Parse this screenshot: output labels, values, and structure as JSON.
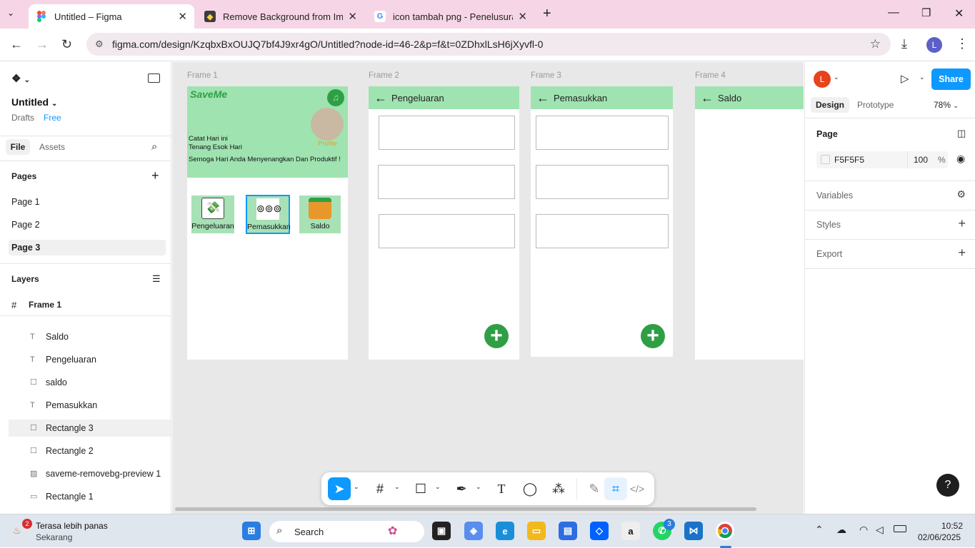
{
  "browser": {
    "tabs": [
      {
        "title": "Untitled – Figma",
        "favicon": "figma-icon",
        "active": true
      },
      {
        "title": "Remove Background from Imag",
        "favicon": "removebg-icon",
        "active": false
      },
      {
        "title": "icon tambah png - Penelusuran",
        "favicon": "google-icon",
        "active": false
      }
    ],
    "url": "figma.com/design/KzqbxBxOUJQ7bf4J9xr4gO/Untitled?node-id=46-2&p=f&t=0ZDhxlLsH6jXyvfl-0",
    "profile_initial": "L"
  },
  "left_panel": {
    "file_title": "Untitled",
    "drafts_label": "Drafts",
    "plan_badge": "Free",
    "tab_file": "File",
    "tab_assets": "Assets",
    "pages_heading": "Pages",
    "pages": [
      "Page 1",
      "Page 2",
      "Page 3"
    ],
    "selected_page": "Page 3",
    "layers_heading": "Layers",
    "frame_layer": "Frame 1",
    "layers": [
      {
        "name": "Saldo",
        "icon": "text-icon"
      },
      {
        "name": "Pengeluaran",
        "icon": "text-icon"
      },
      {
        "name": "saldo",
        "icon": "rectangle-icon"
      },
      {
        "name": "Pemasukkan",
        "icon": "text-icon"
      },
      {
        "name": "Rectangle 3",
        "icon": "rectangle-icon"
      },
      {
        "name": "Rectangle 2",
        "icon": "rectangle-icon"
      },
      {
        "name": "saveme-removebg-preview 1",
        "icon": "image-icon"
      },
      {
        "name": "Rectangle 1",
        "icon": "rectangle-icon"
      }
    ]
  },
  "canvas": {
    "frames": [
      "Frame 1",
      "Frame 2",
      "Frame 3",
      "Frame 4"
    ],
    "frame1": {
      "logo_text": "SaveMe",
      "profile_label": "Profile",
      "line1": "Catat Hari ini",
      "line2": "Tenang Esok Hari",
      "line3": "Semoga Hari Anda Menyenangkan Dan Produktif !",
      "cards": [
        "Pengeluaran",
        "Pemasukkan",
        "Saldo"
      ]
    },
    "frame2_title": "Pengeluaran",
    "frame3_title": "Pemasukkan",
    "frame4_title": "Saldo"
  },
  "right_panel": {
    "avatar_initial": "L",
    "share_label": "Share",
    "tab_design": "Design",
    "tab_prototype": "Prototype",
    "zoom": "78%",
    "page_heading": "Page",
    "page_color": "F5F5F5",
    "page_opacity": "100",
    "opacity_unit": "%",
    "variables_label": "Variables",
    "styles_label": "Styles",
    "export_label": "Export",
    "help_label": "?"
  },
  "taskbar": {
    "weather_title": "Terasa lebih panas",
    "weather_sub": "Sekarang",
    "weather_badge": "2",
    "search_label": "Search",
    "whatsapp_badge": "3",
    "time": "10:52",
    "date": "02/06/2025"
  },
  "colors": {
    "accent_blue": "#0d99ff",
    "frame_green": "#9fe3b0",
    "plus_green": "#2f9f46"
  }
}
